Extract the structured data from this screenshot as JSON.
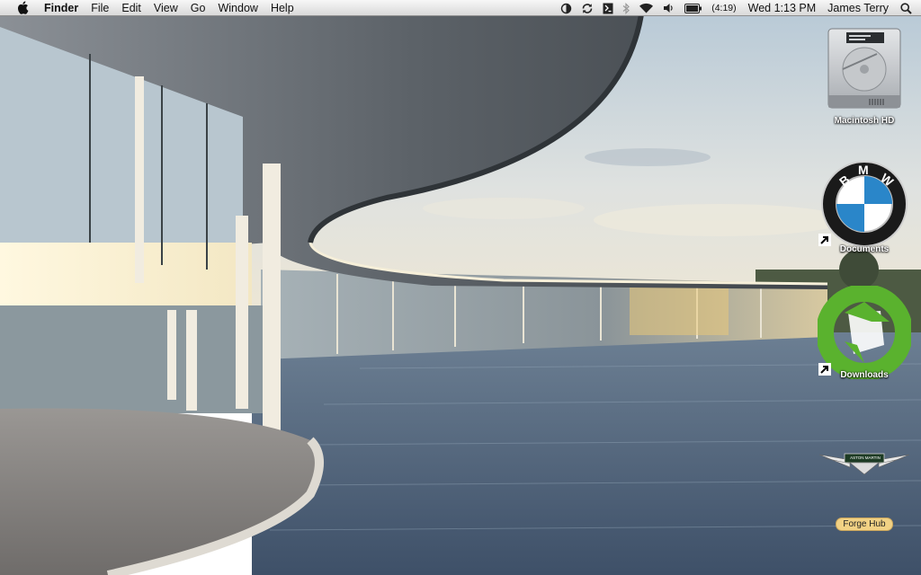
{
  "menubar": {
    "app_name": "Finder",
    "menus": [
      "File",
      "Edit",
      "View",
      "Go",
      "Window",
      "Help"
    ],
    "status": {
      "battery_time": "(4:19)",
      "clock": "Wed 1:13 PM",
      "user": "James Terry"
    },
    "icons": [
      "apple-icon",
      "clock-status-icon",
      "sync-icon",
      "script-icon",
      "bluetooth-icon",
      "wifi-icon",
      "volume-icon",
      "battery-icon",
      "spotlight-icon"
    ]
  },
  "desktop": {
    "icons": [
      {
        "label": "Macintosh HD",
        "icon": "hard-drive-icon"
      },
      {
        "label": "Documents",
        "icon": "bmw-logo-icon",
        "alias": true
      },
      {
        "label": "Downloads",
        "icon": "green-download-icon",
        "alias": true
      },
      {
        "label": "",
        "icon": "aston-martin-logo-icon",
        "badge_text": "ASTON MARTIN"
      },
      {
        "label": "Forge Hub",
        "icon": "forge-hub-label"
      }
    ]
  },
  "wallpaper": {
    "subject": "curved glass building beside a lake",
    "colors": {
      "sky": "#c7d3dc",
      "water": "#5a6e84",
      "building_roof": "#4c5257"
    }
  }
}
